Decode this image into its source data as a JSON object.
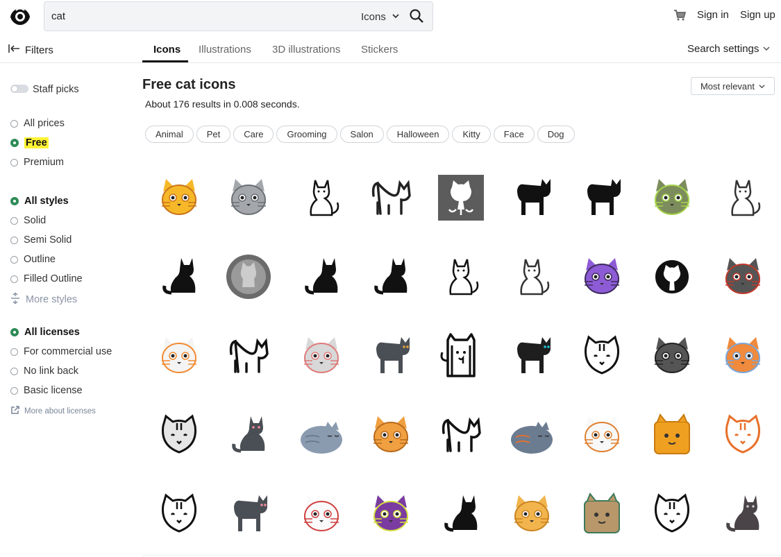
{
  "header": {
    "logo": "eye-logo-icon",
    "search": {
      "value": "cat",
      "type": "Icons"
    },
    "cart_icon": "cart-icon",
    "sign_in": "Sign in",
    "sign_up": "Sign up"
  },
  "toolbar": {
    "filters": "Filters",
    "tabs": [
      {
        "label": "Icons",
        "active": true
      },
      {
        "label": "Illustrations",
        "active": false
      },
      {
        "label": "3D illustrations",
        "active": false
      },
      {
        "label": "Stickers",
        "active": false
      }
    ],
    "search_settings": "Search settings"
  },
  "sidebar": {
    "staff_picks": "Staff picks",
    "prices": [
      {
        "label": "All prices",
        "selected": false
      },
      {
        "label": "Free",
        "selected": true
      },
      {
        "label": "Premium",
        "selected": false
      }
    ],
    "styles": [
      {
        "label": "All styles",
        "selected": true
      },
      {
        "label": "Solid",
        "selected": false
      },
      {
        "label": "Semi Solid",
        "selected": false
      },
      {
        "label": "Outline",
        "selected": false
      },
      {
        "label": "Filled Outline",
        "selected": false
      }
    ],
    "more_styles": "More styles",
    "licenses": [
      {
        "label": "All licenses",
        "selected": true
      },
      {
        "label": "For commercial use",
        "selected": false
      },
      {
        "label": "No link back",
        "selected": false
      },
      {
        "label": "Basic license",
        "selected": false
      }
    ],
    "more_licenses": "More about licenses"
  },
  "main": {
    "title": "Free cat icons",
    "results": "About 176 results in 0.008 seconds.",
    "sort": "Most relevant",
    "tags": [
      "Animal",
      "Pet",
      "Care",
      "Grooming",
      "Salon",
      "Halloween",
      "Kitty",
      "Face",
      "Dog"
    ],
    "icons": [
      {
        "name": "cat-face-emoji-icon",
        "kind": "face",
        "fill": "#f6b829",
        "stroke": "#c9731c"
      },
      {
        "name": "gray-cat-face-icon",
        "kind": "face",
        "fill": "#a4a8ad",
        "stroke": "#6b7075"
      },
      {
        "name": "cat-line-sitting-icon",
        "kind": "outline-sit",
        "fill": "#ffffff",
        "stroke": "#111111"
      },
      {
        "name": "cat-arched-outline-icon",
        "kind": "outline-standing",
        "fill": "#ffffff",
        "stroke": "#222222"
      },
      {
        "name": "github-cat-box-icon",
        "kind": "octocat-box",
        "fill": "#5c5c5c",
        "stroke": "#ffffff"
      },
      {
        "name": "black-cat-standing-icon",
        "kind": "standing",
        "fill": "#111111",
        "stroke": "#111111"
      },
      {
        "name": "black-cat-standing-2-icon",
        "kind": "standing",
        "fill": "#111111",
        "stroke": "#111111"
      },
      {
        "name": "cat-pixel-art-icon",
        "kind": "face",
        "fill": "#7c8c5c",
        "stroke": "#a6d34a"
      },
      {
        "name": "cat-sitting-outline-icon",
        "kind": "outline-sit",
        "fill": "#ffffff",
        "stroke": "#333333"
      },
      {
        "name": "black-cat-sitting-icon",
        "kind": "sitting",
        "fill": "#111111",
        "stroke": "#111111"
      },
      {
        "name": "github-circle-icon",
        "kind": "circle-cat",
        "fill": "#6b6b6b",
        "stroke": "#cccccc"
      },
      {
        "name": "black-cat-lying-icon",
        "kind": "sitting",
        "fill": "#111111",
        "stroke": "#111111"
      },
      {
        "name": "black-cat-lying-2-icon",
        "kind": "sitting",
        "fill": "#111111",
        "stroke": "#111111"
      },
      {
        "name": "cat-sitting-line-icon",
        "kind": "outline-sit",
        "fill": "#ffffff",
        "stroke": "#111111"
      },
      {
        "name": "cat-elegant-line-icon",
        "kind": "outline-sit",
        "fill": "#ffffff",
        "stroke": "#333333"
      },
      {
        "name": "purple-cat-icon",
        "kind": "face",
        "fill": "#8e5bd6",
        "stroke": "#3d2a5c"
      },
      {
        "name": "github-logo-icon",
        "kind": "github",
        "fill": "#111111",
        "stroke": "#111111"
      },
      {
        "name": "cat-costume-icon",
        "kind": "face",
        "fill": "#555555",
        "stroke": "#c0392b"
      },
      {
        "name": "lucky-cat-icon",
        "kind": "face",
        "fill": "#f4f4f4",
        "stroke": "#f28a30"
      },
      {
        "name": "leopard-lying-icon",
        "kind": "outline-standing",
        "fill": "#ffffff",
        "stroke": "#111111"
      },
      {
        "name": "cat-grooming-icon",
        "kind": "face",
        "fill": "#d8d8d8",
        "stroke": "#e07b7b"
      },
      {
        "name": "gray-cat-standing-icon",
        "kind": "standing",
        "fill": "#4a4f55",
        "stroke": "#e6a23c"
      },
      {
        "name": "cat-door-outline-icon",
        "kind": "door",
        "fill": "#ffffff",
        "stroke": "#111111"
      },
      {
        "name": "black-cat-halloween-icon",
        "kind": "standing",
        "fill": "#1e1e1e",
        "stroke": "#1ec7d8"
      },
      {
        "name": "cat-face-outline-icon",
        "kind": "outline-face",
        "fill": "#ffffff",
        "stroke": "#111111"
      },
      {
        "name": "gray-cat-face-2-icon",
        "kind": "face",
        "fill": "#555555",
        "stroke": "#222222"
      },
      {
        "name": "cat-in-cage-icon",
        "kind": "face",
        "fill": "#f08a3c",
        "stroke": "#7aa6d8"
      },
      {
        "name": "striped-cat-face-icon",
        "kind": "outline-face",
        "fill": "#e6e6e6",
        "stroke": "#111111"
      },
      {
        "name": "gray-cat-sitting-icon",
        "kind": "sitting",
        "fill": "#4a4f55",
        "stroke": "#f28aa0"
      },
      {
        "name": "sleeping-cat-icon",
        "kind": "sleeping",
        "fill": "#8a9bb0",
        "stroke": "#6b7c91"
      },
      {
        "name": "orange-cat-dreaming-icon",
        "kind": "face",
        "fill": "#f0a040",
        "stroke": "#b86a1c"
      },
      {
        "name": "cat-tail-line-icon",
        "kind": "outline-standing",
        "fill": "#ffffff",
        "stroke": "#111111"
      },
      {
        "name": "cat-yarn-icon",
        "kind": "sleeping",
        "fill": "#6b7c91",
        "stroke": "#e07030"
      },
      {
        "name": "lucky-cat-2-icon",
        "kind": "face",
        "fill": "#f8f8f8",
        "stroke": "#e08030"
      },
      {
        "name": "orange-box-cat-icon",
        "kind": "box-face",
        "fill": "#f0a020",
        "stroke": "#c77a10"
      },
      {
        "name": "cat-face-orange-line-icon",
        "kind": "outline-face",
        "fill": "#ffffff",
        "stroke": "#e8702a"
      },
      {
        "name": "cat-face-outline-2-icon",
        "kind": "outline-face",
        "fill": "#ffffff",
        "stroke": "#111111"
      },
      {
        "name": "gray-cat-standing-2-icon",
        "kind": "standing",
        "fill": "#4a4f55",
        "stroke": "#f28aa0"
      },
      {
        "name": "lucky-cat-3-icon",
        "kind": "face",
        "fill": "#fafafa",
        "stroke": "#d04040"
      },
      {
        "name": "cheshire-cat-icon",
        "kind": "face",
        "fill": "#7a3ca0",
        "stroke": "#d4e040"
      },
      {
        "name": "black-cat-sitting-2-icon",
        "kind": "sitting",
        "fill": "#111111",
        "stroke": "#111111"
      },
      {
        "name": "orange-cat-face-icon",
        "kind": "face",
        "fill": "#f2b44c",
        "stroke": "#c98420"
      },
      {
        "name": "cat-in-box-icon",
        "kind": "box-face",
        "fill": "#b8976a",
        "stroke": "#3c7a5a"
      },
      {
        "name": "cat-dog-line-icon",
        "kind": "outline-face",
        "fill": "#ffffff",
        "stroke": "#111111"
      },
      {
        "name": "raccoon-cat-icon",
        "kind": "sitting",
        "fill": "#4a4448",
        "stroke": "#d0c8c8"
      }
    ]
  }
}
